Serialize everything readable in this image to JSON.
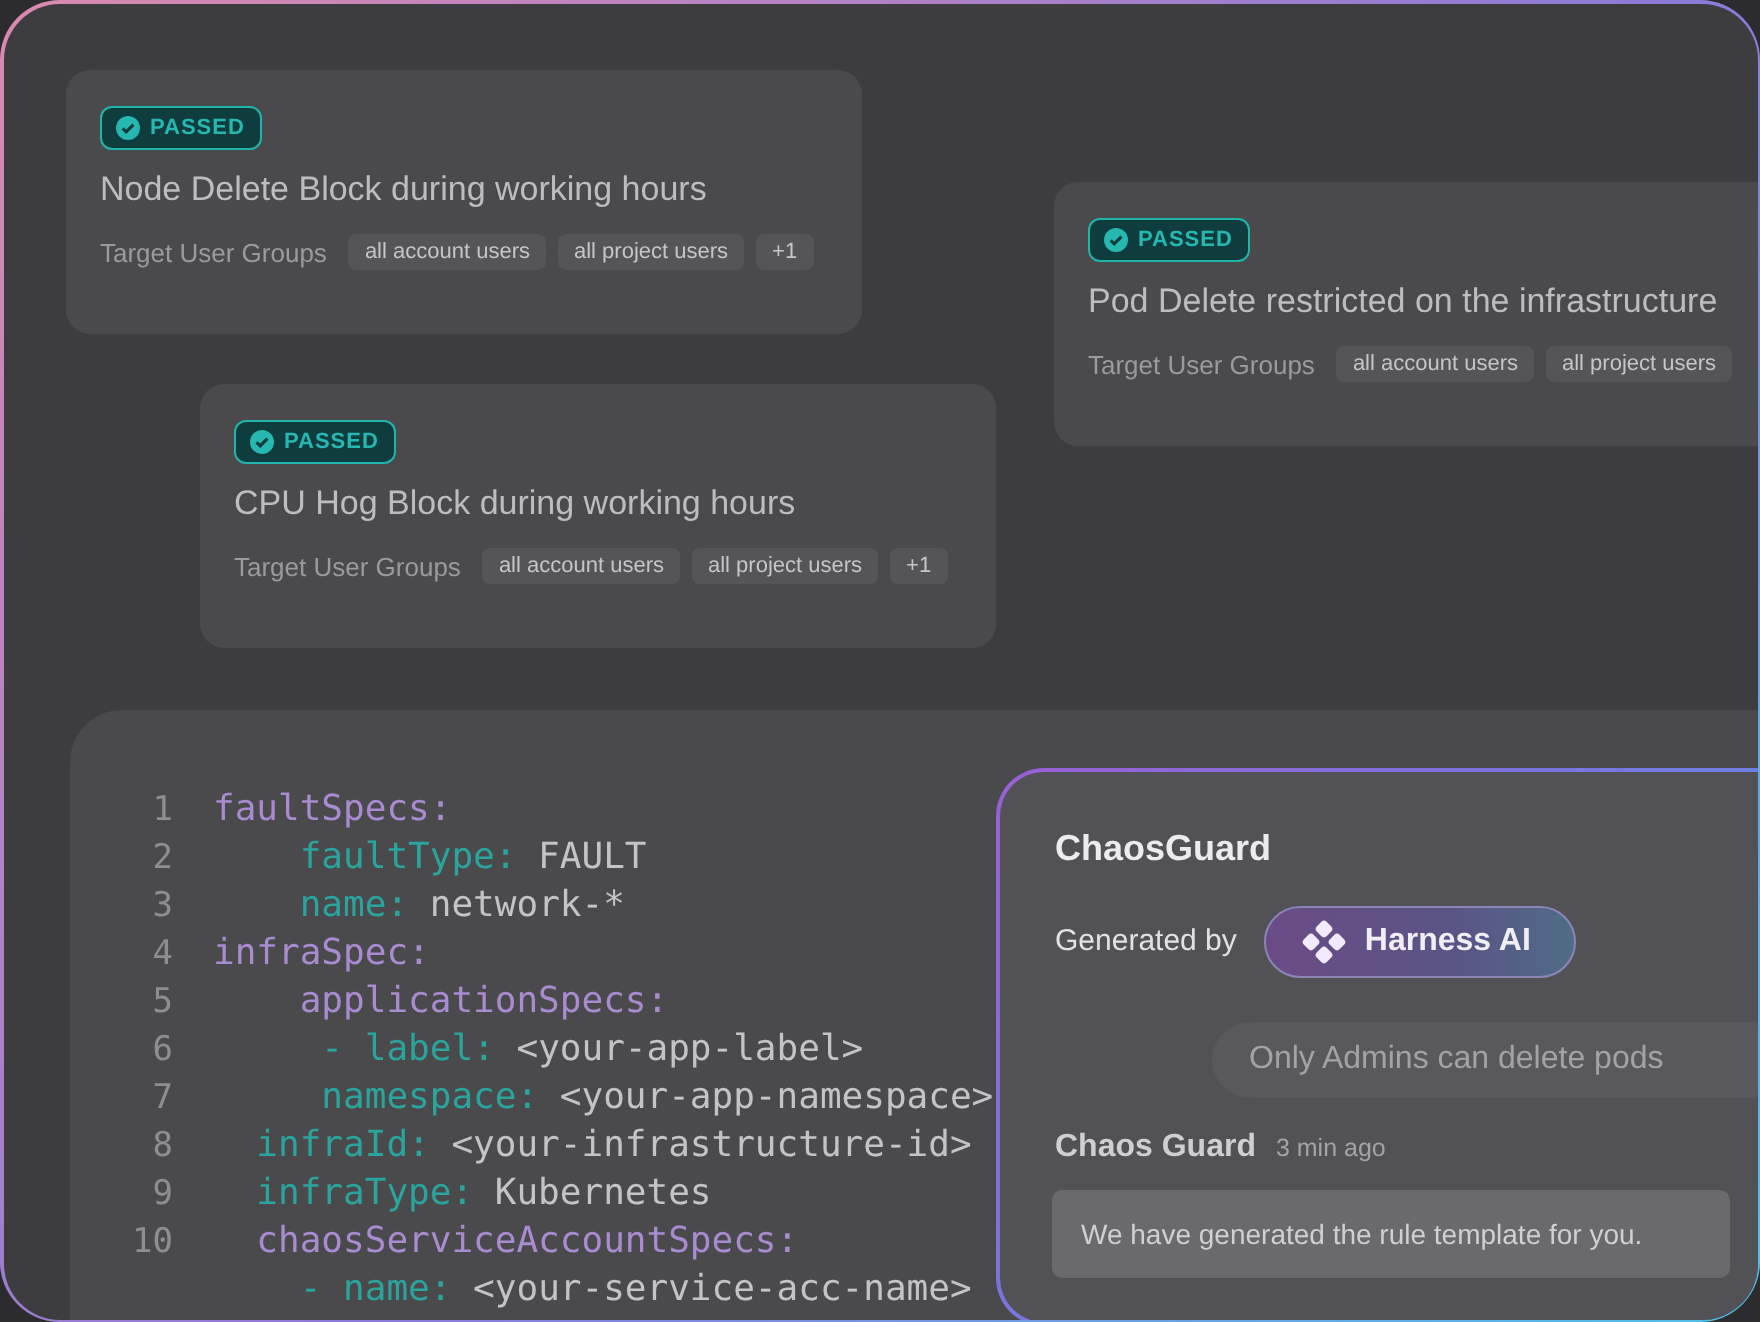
{
  "policy_cards": [
    {
      "status": "PASSED",
      "title": "Node Delete Block during working hours",
      "groups_label": "Target User Groups",
      "groups": [
        "all account users",
        "all project users",
        "+1"
      ]
    },
    {
      "status": "PASSED",
      "title": "Pod Delete restricted on the infrastructure",
      "groups_label": "Target User Groups",
      "groups": [
        "all account users",
        "all project users"
      ]
    },
    {
      "status": "PASSED",
      "title": "CPU Hog Block during working hours",
      "groups_label": "Target User Groups",
      "groups": [
        "all account users",
        "all project users",
        "+1"
      ]
    }
  ],
  "code_editor": {
    "lines": [
      {
        "number": "1",
        "tokens": [
          {
            "kind": "section",
            "text": "faultSpecs:"
          }
        ]
      },
      {
        "number": "2",
        "tokens": [
          {
            "kind": "key",
            "text": "    faultType:"
          },
          {
            "kind": "value",
            "text": " FAULT"
          }
        ]
      },
      {
        "number": "3",
        "tokens": [
          {
            "kind": "key",
            "text": "    name:"
          },
          {
            "kind": "value",
            "text": " network-*"
          }
        ]
      },
      {
        "number": "4",
        "tokens": [
          {
            "kind": "section",
            "text": "infraSpec:"
          }
        ]
      },
      {
        "number": "5",
        "tokens": [
          {
            "kind": "section",
            "text": "    applicationSpecs:"
          }
        ]
      },
      {
        "number": "6",
        "tokens": [
          {
            "kind": "key",
            "text": "     - label:"
          },
          {
            "kind": "value",
            "text": " <your-app-label>"
          }
        ]
      },
      {
        "number": "7",
        "tokens": [
          {
            "kind": "key",
            "text": "     namespace:"
          },
          {
            "kind": "value",
            "text": " <your-app-namespace>"
          }
        ]
      },
      {
        "number": "8",
        "tokens": [
          {
            "kind": "key",
            "text": "  infraId:"
          },
          {
            "kind": "value",
            "text": " <your-infrastructure-id>"
          }
        ]
      },
      {
        "number": "9",
        "tokens": [
          {
            "kind": "key",
            "text": "  infraType:"
          },
          {
            "kind": "value",
            "text": " Kubernetes"
          }
        ]
      },
      {
        "number": "10",
        "tokens": [
          {
            "kind": "section",
            "text": "  chaosServiceAccountSpecs:"
          }
        ]
      },
      {
        "tokens": [
          {
            "kind": "key",
            "text": "    - name:"
          },
          {
            "kind": "value",
            "text": " <your-service-acc-name>"
          }
        ]
      }
    ]
  },
  "chat_panel": {
    "title": "ChaosGuard",
    "generated_by": "Generated by",
    "ai_badge": "Harness AI",
    "user_message": "Only Admins can delete pods",
    "reply": {
      "author": "Chaos Guard",
      "time": "3 min ago",
      "text": "We have generated the rule template for you."
    }
  }
}
